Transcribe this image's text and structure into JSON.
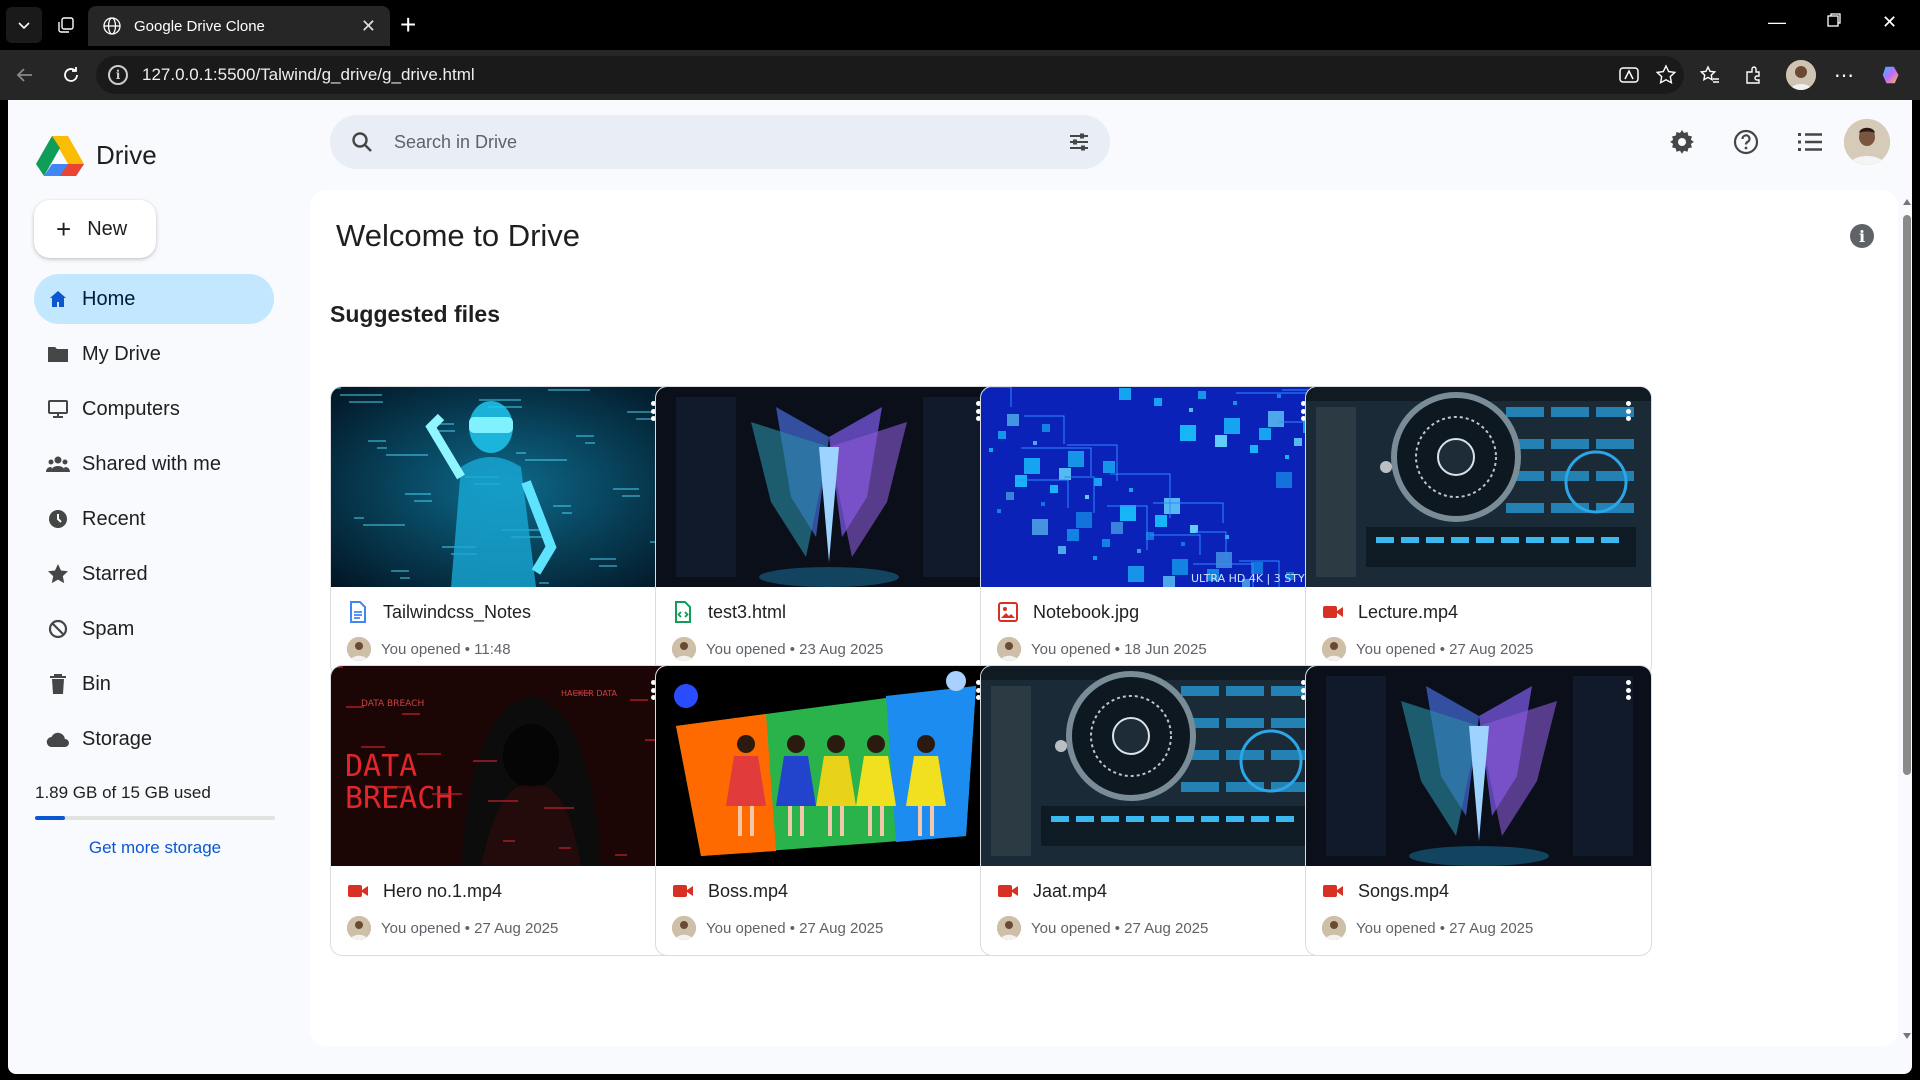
{
  "browser": {
    "tab_title": "Google Drive Clone",
    "url": "127.0.0.1:5500/Talwind/g_drive/g_drive.html"
  },
  "app": {
    "logo_text": "Drive",
    "new_label": "New",
    "search_placeholder": "Search in Drive"
  },
  "sidebar": {
    "items": [
      {
        "label": "Home",
        "icon": "home-icon",
        "active": true
      },
      {
        "label": "My Drive",
        "icon": "folder-icon"
      },
      {
        "label": "Computers",
        "icon": "computer-icon"
      },
      {
        "label": "Shared with me",
        "icon": "people-icon"
      },
      {
        "label": "Recent",
        "icon": "clock-icon"
      },
      {
        "label": "Starred",
        "icon": "star-icon"
      },
      {
        "label": "Spam",
        "icon": "spam-icon"
      },
      {
        "label": "Bin",
        "icon": "bin-icon"
      },
      {
        "label": "Storage",
        "icon": "cloud-icon"
      }
    ],
    "storage_text": "1.89 GB of 15 GB used",
    "storage_fraction": 0.126,
    "get_storage": "Get more storage"
  },
  "main": {
    "welcome": "Welcome to Drive",
    "section_title": "Suggested files",
    "files": [
      {
        "name": "Tailwindcss_Notes",
        "type": "doc",
        "meta": "You opened • 11:48",
        "thumb": "hologram-man"
      },
      {
        "name": "test3.html",
        "type": "code",
        "meta": "You opened • 23 Aug 2025",
        "thumb": "crystal-wings"
      },
      {
        "name": "Notebook.jpg",
        "type": "image",
        "meta": "You opened • 18 Jun 2025",
        "thumb": "blue-circuit"
      },
      {
        "name": "Lecture.mp4",
        "type": "video",
        "meta": "You opened • 27 Aug 2025",
        "thumb": "hud-eye"
      },
      {
        "name": "Hero no.1.mp4",
        "type": "video",
        "meta": "You opened • 27 Aug 2025",
        "thumb": "data-breach"
      },
      {
        "name": "Boss.mp4",
        "type": "video",
        "meta": "You opened • 27 Aug 2025",
        "thumb": "dancers"
      },
      {
        "name": "Jaat.mp4",
        "type": "video",
        "meta": "You opened • 27 Aug 2025",
        "thumb": "hud-eye"
      },
      {
        "name": "Songs.mp4",
        "type": "video",
        "meta": "You opened • 27 Aug 2025",
        "thumb": "crystal-wings"
      }
    ]
  },
  "colors": {
    "accent": "#0b57d0",
    "active_nav": "#c2e7ff",
    "video_red": "#d93025",
    "doc_blue": "#4285f4",
    "code_green": "#0f9d58"
  }
}
